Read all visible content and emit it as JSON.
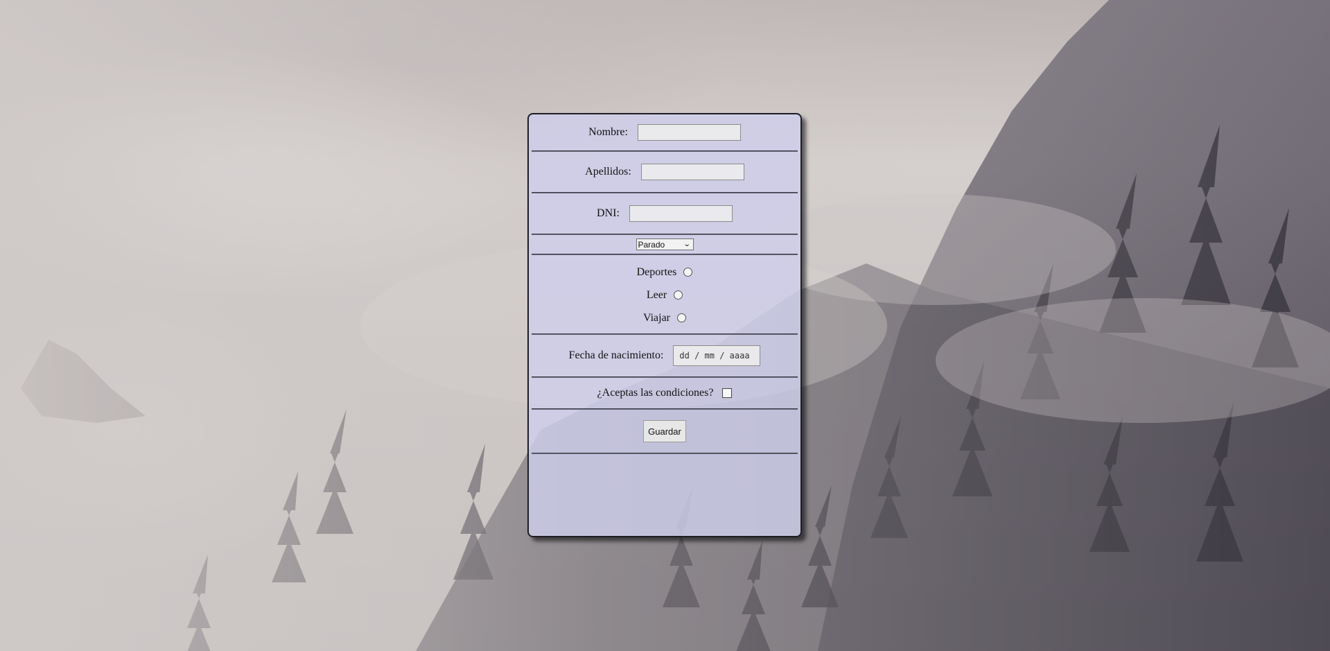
{
  "form": {
    "nombre_label": "Nombre:",
    "nombre_value": "",
    "apellidos_label": "Apellidos:",
    "apellidos_value": "",
    "dni_label": "DNI:",
    "dni_value": "",
    "situacion_selected": "Parado",
    "hobbies": [
      {
        "label": "Deportes",
        "checked": false
      },
      {
        "label": "Leer",
        "checked": false
      },
      {
        "label": "Viajar",
        "checked": false
      }
    ],
    "fecha_label": "Fecha de nacimiento:",
    "fecha_placeholder": "dd / mm / aaaa",
    "condiciones_label": "¿Aceptas las condiciones?",
    "condiciones_checked": false,
    "guardar_label": "Guardar"
  },
  "icons": {
    "select_arrow": "chevron-down-icon"
  },
  "colors": {
    "panel_background": "#cecedc",
    "panel_border": "#1c1c22"
  }
}
